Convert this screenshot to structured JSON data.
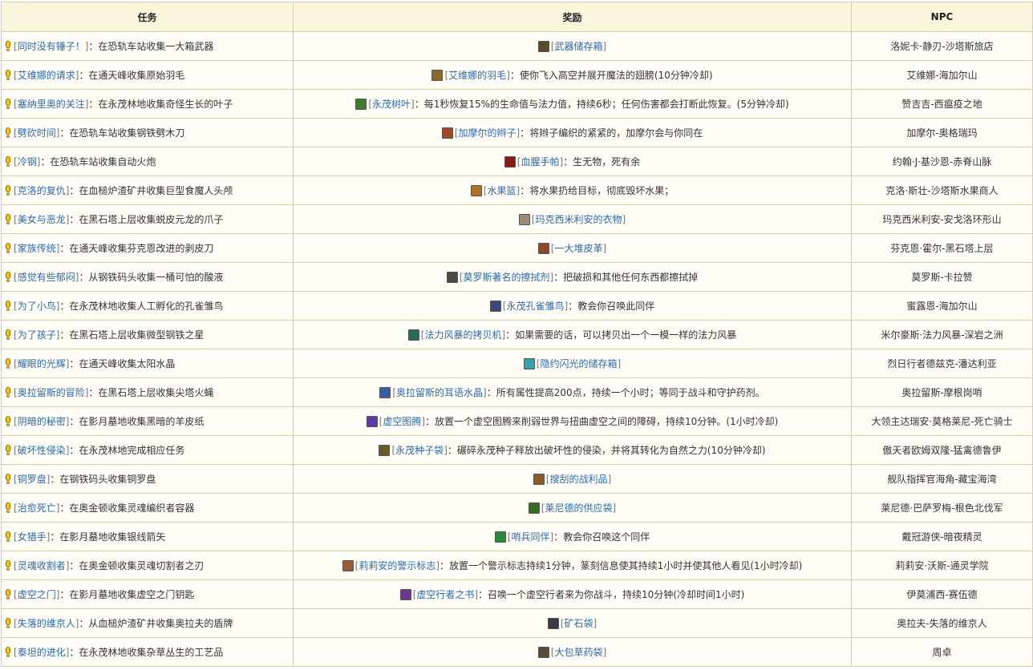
{
  "headers": {
    "task": "任务",
    "reward": "奖励",
    "npc": "NPC"
  },
  "rows": [
    {
      "task": "同时没有锤子！",
      "task_desc": "：在恐轨车站收集一大箱武器",
      "reward": "武器储存箱",
      "reward_desc": "",
      "npc": "洛妮卡·静刃-沙塔斯旅店",
      "icon_color": "#5a4a2e"
    },
    {
      "task": "艾维娜的请求",
      "task_desc": "：在通天峰收集原始羽毛",
      "reward": "艾维娜的羽毛",
      "reward_desc": "：使你飞入高空并展开魔法的翅膀(10分钟冷却)",
      "npc": "艾维娜-海加尔山",
      "icon_color": "#8a6a2a"
    },
    {
      "task": "塞纳里奥的关注",
      "task_desc": "：在永茂林地收集奇怪生长的叶子",
      "reward": "永茂树叶",
      "reward_desc": "：每1秒恢复15%的生命值与法力值，持续6秒；任何伤害都会打断此恢复。(5分钟冷却)",
      "npc": "赞吉吉-西瘟疫之地",
      "icon_color": "#3d7a2a"
    },
    {
      "task": "劈砍时间",
      "task_desc": "：在恐轨车站收集钢铁劈木刀",
      "reward": "加摩尔的辫子",
      "reward_desc": "：将辫子编织的紧紧的，加摩尔会与你同在",
      "npc": "加摩尔-奥格瑞玛",
      "icon_color": "#a04a2a"
    },
    {
      "task": "冷钢",
      "task_desc": "：在恐轨车站收集自动火炮",
      "reward": "血腥手帕",
      "reward_desc": "：生无物，死有余",
      "npc": "约翰·J·基沙恩-赤脊山脉",
      "icon_color": "#8a1a1a"
    },
    {
      "task": "克洛的复仇",
      "task_desc": "：在血槌炉渣矿井收集巨型食魔人头颅",
      "reward": "水果篮",
      "reward_desc": "：将水果扔给目标，彻底毁坏水果；",
      "npc": "克洛·斯壮-沙塔斯水果商人",
      "icon_color": "#b0702a"
    },
    {
      "task": "美女与恶龙",
      "task_desc": "：在黑石塔上层收集蜕皮元龙的爪子",
      "reward": "玛克西米利安的衣物",
      "reward_desc": "",
      "npc": "玛克西米利安-安戈洛环形山",
      "icon_color": "#9a8a7a"
    },
    {
      "task": "家族传统",
      "task_desc": "：在通天峰收集芬克恩改进的剥皮刀",
      "reward": "一大堆皮革",
      "reward_desc": "",
      "npc": "芬克恩·霍尔-黑石塔上层",
      "icon_color": "#8a4a2a"
    },
    {
      "task": "感觉有些郁闷",
      "task_desc": "：从钢铁码头收集一桶可怕的酸液",
      "reward": "莫罗斯著名的擦拭剂",
      "reward_desc": "：把破损和其他任何东西都擦拭掉",
      "npc": "莫罗斯-卡拉赞",
      "icon_color": "#4a4a4a"
    },
    {
      "task": "为了小鸟",
      "task_desc": "：在永茂林地收集人工孵化的孔雀雏鸟",
      "reward": "永茂孔雀雏鸟",
      "reward_desc": "：教会你召唤此同伴",
      "npc": "蜜露恩-海加尔山",
      "icon_color": "#3a4a7a"
    },
    {
      "task": "为了孩子",
      "task_desc": "：在黑石塔上层收集微型钢铁之星",
      "reward": "法力风暴的拷贝机",
      "reward_desc": "：如果需要的话，可以拷贝出一个一模一样的法力风暴",
      "npc": "米尔豪斯·法力风暴-深岩之洲",
      "icon_color": "#2a6a5a"
    },
    {
      "task": "耀眼的光辉",
      "task_desc": "：在通天峰收集太阳水晶",
      "reward": "隐约闪光的储存箱",
      "reward_desc": "",
      "npc": "烈日行者德兹克-潘达利亚",
      "icon_color": "#3aa0b0"
    },
    {
      "task": "奥拉留斯的冒险",
      "task_desc": "：在黑石塔上层收集尖塔火蝇",
      "reward": "奥拉留斯的耳语水晶",
      "reward_desc": "：所有属性提高200点，持续一个小时；等同于战斗和守护药剂。",
      "npc": "奥拉留斯-摩根岗哨",
      "icon_color": "#3a5aa0"
    },
    {
      "task": "阴暗的秘密",
      "task_desc": "：在影月墓地收集黑暗的羊皮纸",
      "reward": "虚空图腾",
      "reward_desc": "：放置一个虚空图腾来削弱世界与扭曲虚空之间的障碍，持续10分钟。(1小时冷却)",
      "npc": "大领主达瑞安·莫格莱尼-死亡骑士",
      "icon_color": "#5a3a9a"
    },
    {
      "task": "破坏性侵染",
      "task_desc": "：在永茂林地完成相应任务",
      "reward": "永茂种子袋",
      "reward_desc": "：碾碎永茂种子释放出破坏性的侵染，并将其转化为自然之力(10分钟冷却)",
      "npc": "傲天者欧姆双隆-猛禽德鲁伊",
      "icon_color": "#6a5a2a"
    },
    {
      "task": "铜罗盘",
      "task_desc": "：在钢铁码头收集铜罗盘",
      "reward": "搜刮的战利品",
      "reward_desc": "",
      "npc": "舰队指挥官海角-藏宝海湾",
      "icon_color": "#8a5a2a"
    },
    {
      "task": "治愈死亡",
      "task_desc": "：在奥金顿收集灵魂编织者容器",
      "reward": "莱尼德的供应袋",
      "reward_desc": "",
      "npc": "莱尼德·巴萨罗梅-根色北伐军",
      "icon_color": "#3a6a2a"
    },
    {
      "task": "女猎手",
      "task_desc": "：在影月墓地收集银线箭矢",
      "reward": "哨兵同伴",
      "reward_desc": "：教会你召唤这个同伴",
      "npc": "戴冠游侠-暗夜精灵",
      "icon_color": "#2a8a3a"
    },
    {
      "task": "灵魂收割者",
      "task_desc": "：在奥金顿收集灵魂切割者之刃",
      "reward": "莉莉安的警示标志",
      "reward_desc": "：放置一个警示标志持续1分钟，篆刻信息使其持续1小时并使其他人看见(1小时冷却)",
      "npc": "莉莉安·沃斯-通灵学院",
      "icon_color": "#9a5a3a"
    },
    {
      "task": "虚空之门",
      "task_desc": "：在影月墓地收集虚空之门钥匙",
      "reward": "虚空行者之书",
      "reward_desc": "：召唤一个虚空行者来为你战斗，持续10分钟(冷却时间1小时)",
      "npc": "伊莫浦西-赛伍德",
      "icon_color": "#6a3a8a"
    },
    {
      "task": "失落的维京人",
      "task_desc": "：从血槌炉渣矿井收集奥拉夫的盾牌",
      "reward": "矿石袋",
      "reward_desc": "",
      "npc": "奥拉夫-失落的维京人",
      "icon_color": "#3a3a4a"
    },
    {
      "task": "泰坦的进化",
      "task_desc": "：在永茂林地收集杂草丛生的工艺品",
      "reward": "大包草药袋",
      "reward_desc": "",
      "npc": "周卓",
      "icon_color": "#5a4a3a"
    }
  ]
}
